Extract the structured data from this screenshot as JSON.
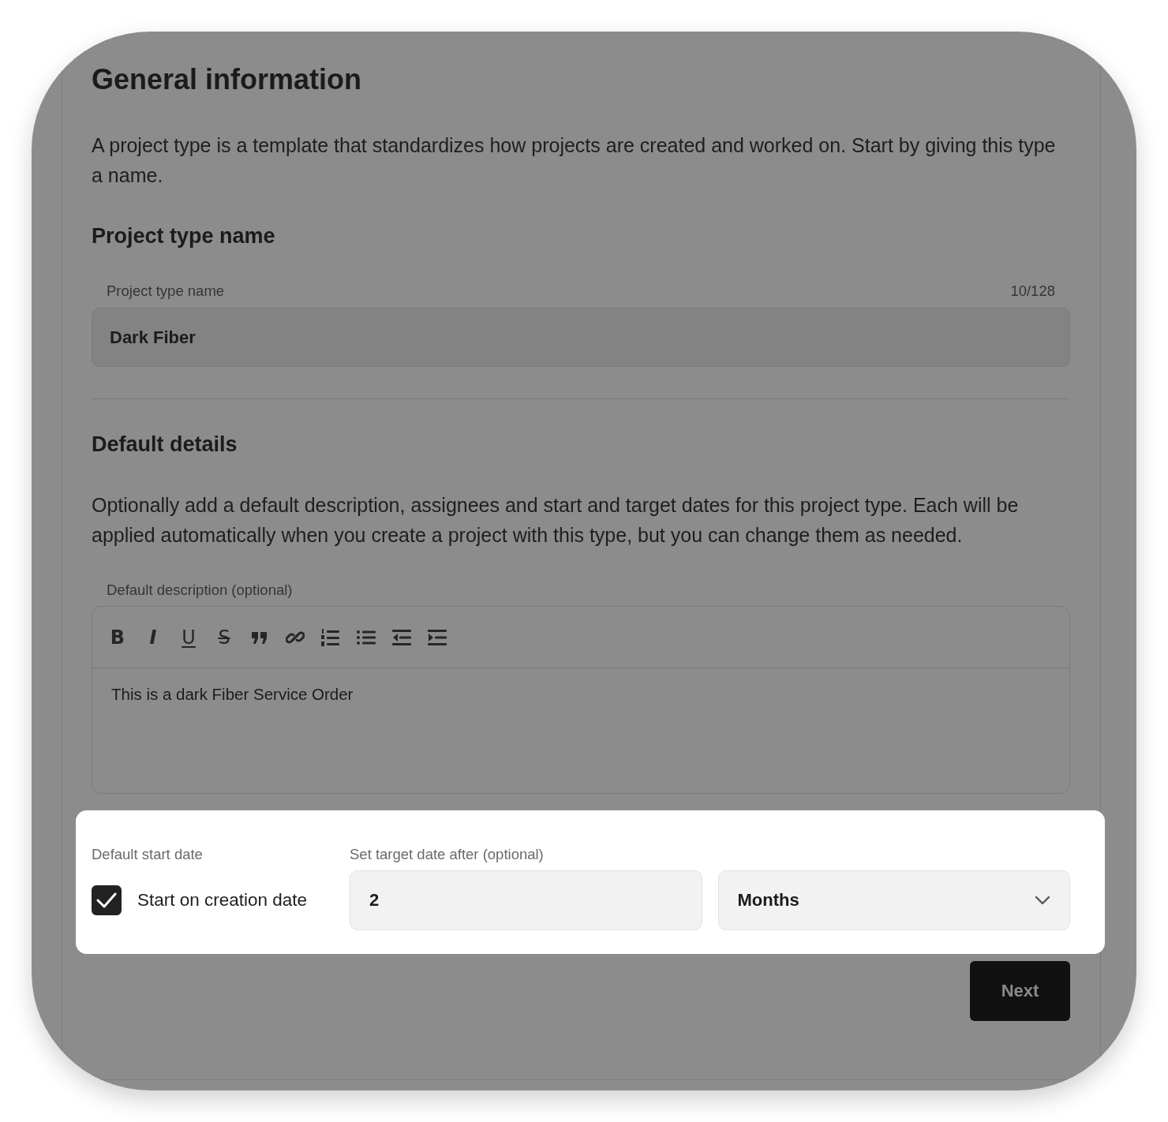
{
  "title": "General information",
  "intro": "A project type is a template that standardizes how projects are created and worked on. Start by giving this type a name.",
  "name_section": {
    "heading": "Project type name",
    "field": {
      "label": "Project type name",
      "counter": "10/128",
      "value": "Dark Fiber"
    }
  },
  "details": {
    "heading": "Default details",
    "text": "Optionally add a default description, assignees and start and target dates for this project type. Each will be applied automatically when you create a project with this type, but you can change them as needed.",
    "description": {
      "label": "Default description (optional)",
      "toolbar": [
        {
          "kind": "bold",
          "glyph": "B"
        },
        {
          "kind": "italic",
          "glyph": "I"
        },
        {
          "kind": "underline",
          "glyph": "U"
        },
        {
          "kind": "strike",
          "glyph": "S"
        },
        {
          "kind": "quote"
        },
        {
          "kind": "link"
        },
        {
          "kind": "ordered"
        },
        {
          "kind": "bullets"
        },
        {
          "kind": "outdent"
        },
        {
          "kind": "indent"
        }
      ],
      "value": "This is a dark Fiber Service Order"
    }
  },
  "dates": {
    "start_label": "Default start date",
    "start_on_creation": {
      "label": "Start on creation date",
      "checked": true
    },
    "target_label": "Set target date after (optional)",
    "amount": "2",
    "unit": "Months"
  },
  "next_button": "Next"
}
